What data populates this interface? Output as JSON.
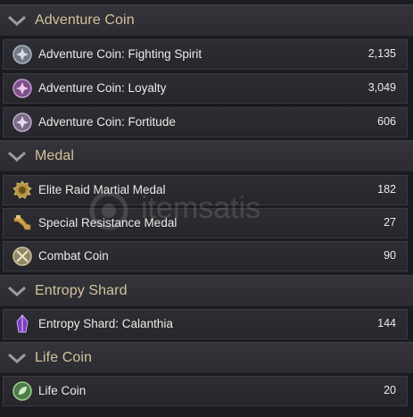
{
  "sections": [
    {
      "title": "Adventure Coin",
      "items": [
        {
          "label": "Adventure Coin: Fighting Spirit",
          "value": "2,135",
          "icon": "fighting-spirit-coin-icon"
        },
        {
          "label": "Adventure Coin: Loyalty",
          "value": "3,049",
          "icon": "loyalty-coin-icon"
        },
        {
          "label": "Adventure Coin: Fortitude",
          "value": "606",
          "icon": "fortitude-coin-icon"
        }
      ]
    },
    {
      "title": "Medal",
      "items": [
        {
          "label": "Elite Raid Martial Medal",
          "value": "182",
          "icon": "martial-medal-icon"
        },
        {
          "label": "Special Resistance Medal",
          "value": "27",
          "icon": "resistance-medal-icon"
        },
        {
          "label": "Combat Coin",
          "value": "90",
          "icon": "combat-coin-icon"
        }
      ]
    },
    {
      "title": "Entropy Shard",
      "items": [
        {
          "label": "Entropy Shard: Calanthia",
          "value": "144",
          "icon": "entropy-shard-icon"
        }
      ]
    },
    {
      "title": "Life Coin",
      "items": [
        {
          "label": "Life Coin",
          "value": "20",
          "icon": "life-coin-icon"
        }
      ]
    }
  ],
  "watermark": {
    "text": "itemsatis"
  },
  "colors": {
    "header_text": "#d4c29a",
    "row_text": "#ecebe6",
    "background": "#1b1c21"
  }
}
